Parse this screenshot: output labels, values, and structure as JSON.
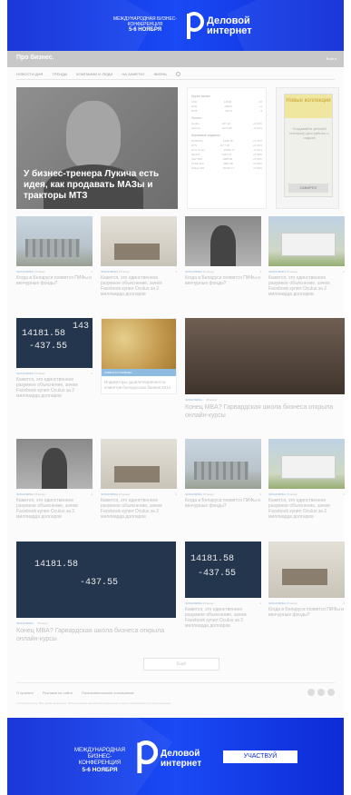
{
  "banner_top": {
    "conference": "Международная бизнес-конференция",
    "dates": "5-6 ноября",
    "title_line1": "Деловой",
    "title_line2": "интернет"
  },
  "header": {
    "logo": "Про бизнес.",
    "login": "Войти"
  },
  "nav": [
    "Новости дня",
    "Тренды",
    "Компании и люди",
    "На заметку",
    "Жизнь"
  ],
  "hero": {
    "title": "У бизнес-тренера Лукича есть идея, как продавать МАЗы и тракторы МТЗ"
  },
  "rates": {
    "title": "Курсы валют",
    "currencies": [
      {
        "code": "USD",
        "value": "14900",
        "change": "-10"
      },
      {
        "code": "EUR",
        "value": "18900",
        "change": "+4"
      },
      {
        "code": "RUB",
        "value": "325.8",
        "change": "-3"
      }
    ],
    "gold_title": "Золото",
    "gold": [
      {
        "code": "Нефть",
        "value": "107.20",
        "change": "+0.81%"
      },
      {
        "code": "Золото",
        "value": "1271.89",
        "change": "-0.14%"
      }
    ],
    "indices_title": "Биржевые индексы",
    "indices": [
      {
        "code": "NASDAQ",
        "value": "4366.48",
        "change": "+0.47%"
      },
      {
        "code": "RTS",
        "value": "1177.26",
        "change": "+0.93%"
      },
      {
        "code": "Dow Jones",
        "value": "16999.77",
        "change": "-0.12%"
      },
      {
        "code": "MICEX",
        "value": "1434.07",
        "change": "+0.38%"
      },
      {
        "code": "S&P 500",
        "value": "1969.95",
        "change": "+0.15%"
      },
      {
        "code": "FTSE 100",
        "value": "6869.85",
        "change": "+0.26%"
      },
      {
        "code": "Nikkei 225",
        "value": "15433.71",
        "change": "+0.59%"
      }
    ]
  },
  "ad": {
    "headline": "Новые коллекции",
    "text": "Создавайте уютный интерьер для работы и отдыха",
    "brand": "СКВИРЕЛ"
  },
  "cards": [
    {
      "category": "ЭКОНОМИКА",
      "time": "15 минут",
      "comments": "1",
      "title": "Когда в Беларуси появятся ПИФы и венчурные фонды?"
    },
    {
      "category": "ЭКОНОМИКА",
      "time": "15 минут",
      "comments": "1",
      "title": "Кажется, это единственное разумное объяснение, зачем Facebook купил Oculus за 2 миллиарда долларов"
    },
    {
      "category": "ЭКОНОМИКА",
      "time": "15 минут",
      "comments": "1",
      "title": "Когда в Беларуси появятся ПИФы и венчурные фонды?"
    },
    {
      "category": "ЭКОНОМИКА",
      "time": "15 минут",
      "comments": "1",
      "title": "Кажется, это единственное разумное объяснение, зачем Facebook купил Oculus за 2 миллиарда долларов"
    },
    {
      "category": "ЭКОНОМИКА",
      "time": "15 минут",
      "comments": "1",
      "title": "Кажется, это единственное разумное объяснение, зачем Facebook купил Oculus за 2 миллиарда долларов"
    }
  ],
  "promo": {
    "tag": "КЛИЕНТЫ И БИЗНЕС",
    "title": "Индикаторы удовлетворенности клиентов белорусских банков 2014"
  },
  "wide_cards": [
    {
      "category": "ЭКОНОМИКА",
      "time": "15 минут",
      "title": "Конец MBA? Гарвардская школа бизнеса открыла онлайн-курсы"
    },
    {
      "category": "ЭКОНОМИКА",
      "time": "15 минут",
      "title": "Конец MBA? Гарвардская школа бизнеса открыла онлайн-курсы"
    }
  ],
  "cards_row3": [
    {
      "category": "ЭКОНОМИКА",
      "time": "15 минут",
      "comments": "1",
      "title": "Кажется, это единственное разумное объяснение, зачем Facebook купил Oculus за 2 миллиарда долларов"
    },
    {
      "category": "ЭКОНОМИКА",
      "time": "15 минут",
      "comments": "1",
      "title": "Кажется, это единственное разумное объяснение, зачем Facebook купил Oculus за 2 миллиарда долларов"
    },
    {
      "category": "ЭКОНОМИКА",
      "time": "15 минут",
      "comments": "1",
      "title": "Когда в Беларуси появятся ПИФы и венчурные фонды?"
    },
    {
      "category": "ЭКОНОМИКА",
      "time": "15 минут",
      "comments": "1",
      "title": "Кажется, это единственное разумное объяснение, зачем Facebook купил Oculus за 2 миллиарда долларов"
    }
  ],
  "cards_row4": [
    {
      "category": "ЭКОНОМИКА",
      "time": "15 минут",
      "comments": "1",
      "title": "Кажется, это единственное разумное объяснение, зачем Facebook купил Oculus за 2 миллиарда долларов"
    },
    {
      "category": "ЭКОНОМИКА",
      "time": "15 минут",
      "comments": "1",
      "title": "Когда в Беларуси появятся ПИФы и венчурные фонды?"
    }
  ],
  "board_numbers": {
    "a": "14181.58",
    "b": "-437.55",
    "c": "143"
  },
  "more_button": "Ещё",
  "footer": {
    "links": [
      "О проекте",
      "Реклама на сайте",
      "Пользовательское соглашение"
    ],
    "copyright": "© Probusiness.by. Все права защищены. Использование материалов разрешено только с письменного согласия редакции."
  },
  "banner_bottom": {
    "conference": "Международная бизнес-конференция",
    "dates": "5-6 ноября",
    "title_line1": "Деловой",
    "title_line2": "интернет",
    "button": "УЧАСТВУЙ"
  },
  "colors": {
    "brand_blue": "#1a4af5",
    "category_blue": "#8db4d8"
  }
}
